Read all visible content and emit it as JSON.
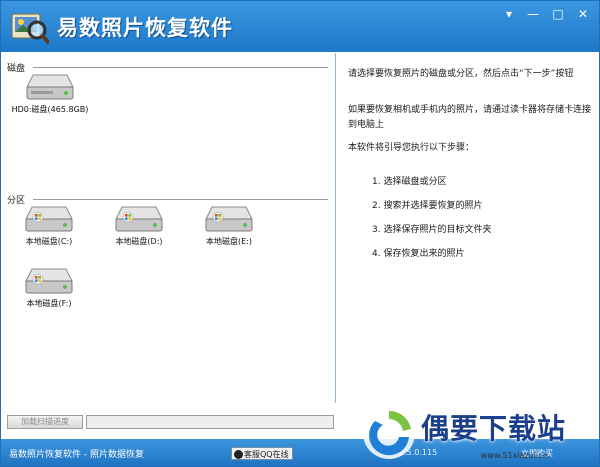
{
  "window": {
    "title": "易数照片恢复软件",
    "controls": {
      "menu": "▾",
      "minimize": "—",
      "maximize": "□",
      "close": "✕"
    }
  },
  "left": {
    "disk_section": "磁盘",
    "disks": [
      {
        "label": "HD0:磁盘(465.8GB)",
        "icon": "hard-disk-icon"
      }
    ],
    "partition_section": "分区",
    "partitions": [
      {
        "label": "本地磁盘(C:)",
        "icon": "windows-drive-icon"
      },
      {
        "label": "本地磁盘(D:)",
        "icon": "windows-drive-icon"
      },
      {
        "label": "本地磁盘(E:)",
        "icon": "windows-drive-icon"
      },
      {
        "label": "本地磁盘(F:)",
        "icon": "windows-drive-icon"
      }
    ]
  },
  "right": {
    "para1": "请选择要恢复照片的磁盘或分区，然后点击“下一步”按钮",
    "para2": "如果要恢复相机或手机内的照片，请通过读卡器将存储卡连接到电脑上",
    "para3": "本软件将引导您执行以下步骤：",
    "steps": [
      "1.  选择磁盘或分区",
      "2.  搜索并选择要恢复的照片",
      "3.  选择保存照片的目标文件夹",
      "4.  保存恢复出来的照片"
    ]
  },
  "progress": {
    "button_label": "加载扫描进度"
  },
  "status": {
    "left_text": "易数照片恢复软件 - 照片数据恢复",
    "service_label": "客服QQ在线",
    "version_text": "2.5.0.115",
    "buy_label": "立即购买"
  },
  "watermark": {
    "text": "偶要下载站",
    "domain": "www.51xiazai.cn"
  },
  "colors": {
    "titlebar": "#2a86d6",
    "statusbar": "#2b84cf",
    "accent": "#1f6fb6"
  }
}
